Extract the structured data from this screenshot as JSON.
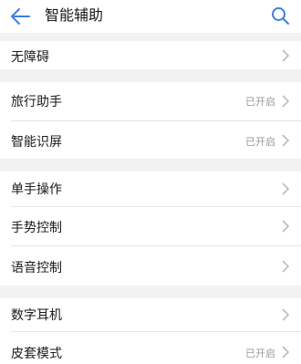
{
  "header": {
    "title": "智能辅助",
    "back_icon": "back-arrow-icon",
    "search_icon": "search-icon",
    "accent": "#3f7ee0"
  },
  "items": [
    {
      "label": "无障碍",
      "status": ""
    },
    {
      "label": "旅行助手",
      "status": "已开启"
    },
    {
      "label": "智能识屏",
      "status": "已开启"
    },
    {
      "label": "单手操作",
      "status": ""
    },
    {
      "label": "手势控制",
      "status": ""
    },
    {
      "label": "语音控制",
      "status": ""
    },
    {
      "label": "数字耳机",
      "status": ""
    },
    {
      "label": "皮套模式",
      "status": "已开启"
    }
  ]
}
